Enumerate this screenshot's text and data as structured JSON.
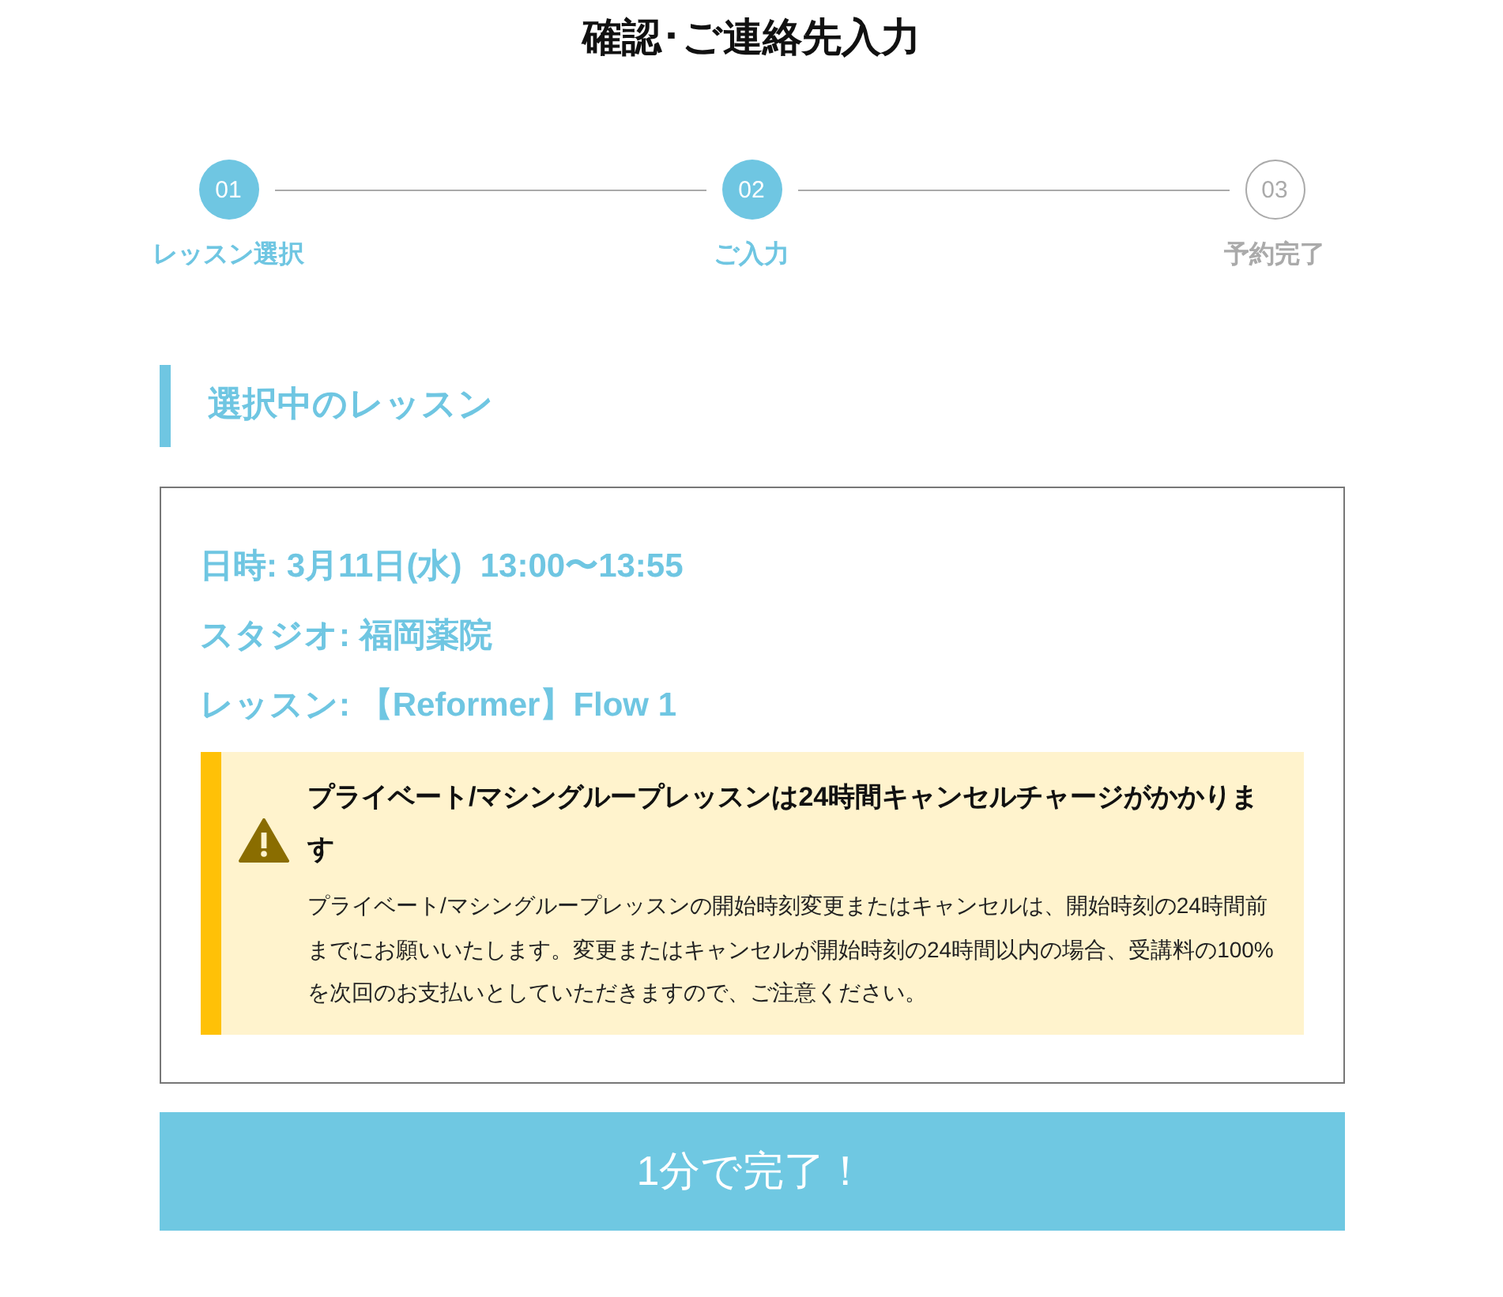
{
  "page_title": "確認･ご連絡先入力",
  "steps": [
    {
      "number": "01",
      "label": "レッスン選択",
      "active": true
    },
    {
      "number": "02",
      "label": "ご入力",
      "active": true
    },
    {
      "number": "03",
      "label": "予約完了",
      "active": false
    }
  ],
  "section_heading": "選択中のレッスン",
  "lesson": [
    {
      "label": "日時:",
      "value": "3月11日(水)  13:00〜13:55"
    },
    {
      "label": "スタジオ:",
      "value": "福岡薬院"
    },
    {
      "label": "レッスン:",
      "value": "【Reformer】Flow 1"
    }
  ],
  "notice": {
    "title": "プライベート/マシングループレッスンは24時間キャンセルチャージがかかります",
    "body": "プライベート/マシングループレッスンの開始時刻変更またはキャンセルは、開始時刻の24時間前までにお願いいたします。変更またはキャンセルが開始時刻の24時間以内の場合、受講料の100%を次回のお支払いとしていただきますので、ご注意ください。"
  },
  "submit_button": "1分で完了！"
}
